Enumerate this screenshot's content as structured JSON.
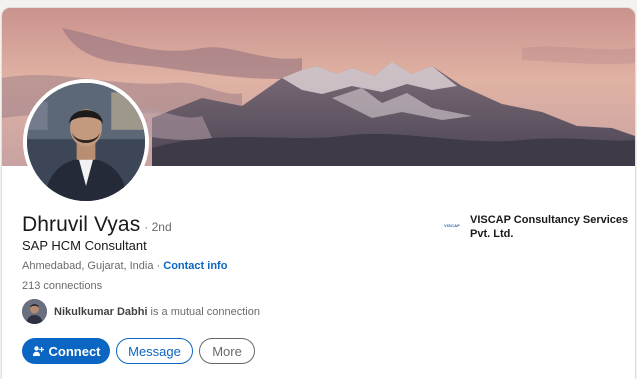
{
  "profile": {
    "name": "Dhruvil Vyas",
    "degree": "· 2nd",
    "headline": "SAP HCM Consultant",
    "location": "Ahmedabad, Gujarat, India ·",
    "contact_link": "Contact info",
    "connections": "213 connections"
  },
  "mutual": {
    "name": "Nikulkumar Dabhi",
    "suffix": "is a mutual connection"
  },
  "actions": {
    "connect_label": "Connect",
    "message_label": "Message",
    "more_label": "More"
  },
  "company": {
    "logo_text": "VISCAP",
    "name": "VISCAP Consultancy Services Pvt. Ltd."
  },
  "colors": {
    "accent": "#0a66c2",
    "banner_sky": "#d9a59a"
  }
}
